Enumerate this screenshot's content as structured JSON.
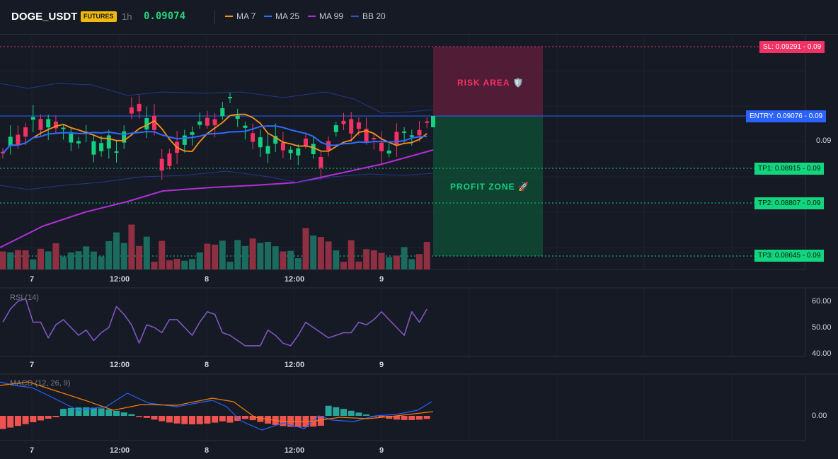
{
  "header": {
    "symbol": "DOGE_USDT",
    "badge": "FUTURES",
    "timeframe": "1h",
    "last_price": "0.09074",
    "legend": [
      {
        "label": "MA 7",
        "color": "#f7931a"
      },
      {
        "label": "MA 25",
        "color": "#2f6bff"
      },
      {
        "label": "MA 99",
        "color": "#b02fd6"
      },
      {
        "label": "BB 20",
        "color": "#23378a"
      }
    ]
  },
  "colors": {
    "bull": "#13d17f",
    "bear": "#f23264",
    "vol_bull": "#1b6b5f",
    "vol_bear": "#8e2f42",
    "ma7": "#f7931a",
    "ma25": "#2f6bff",
    "ma99": "#b02fd6",
    "bb": "#23378a",
    "rsi": "#7e57c2",
    "macd": "#2962ff",
    "signal": "#f57c00",
    "hist_pos": "#26a69a",
    "hist_neg": "#ef5350"
  },
  "trade": {
    "risk_label": "RISK AREA 🛡️",
    "profit_label": "PROFIT ZONE 🚀",
    "sl": "SL: 0.09291 - 0.09",
    "entry": "ENTRY: 0.09076 - 0.09",
    "tp1": "TP1: 0.08915 - 0.09",
    "tp2": "TP2: 0.08807 - 0.09",
    "tp3": "TP3: 0.08645 - 0.09"
  },
  "price_axis": {
    "tick": "0.09"
  },
  "time_axis": [
    "7",
    "12:00",
    "8",
    "12:00",
    "9"
  ],
  "rsi": {
    "label": "RSI (14)",
    "ticks": [
      "60.00",
      "50.00",
      "40.00"
    ],
    "values": [
      52,
      57,
      60,
      61,
      52,
      52,
      46,
      51,
      53,
      50,
      47,
      49,
      45,
      48,
      50,
      58,
      55,
      51,
      44,
      51,
      50,
      48,
      53,
      53,
      50,
      47,
      52,
      56,
      55,
      48,
      47,
      45,
      43,
      43,
      43,
      49,
      47,
      44,
      43,
      47,
      52,
      50,
      48,
      46,
      47,
      48,
      48,
      52,
      51,
      53,
      56,
      53,
      50,
      47,
      56,
      52,
      57
    ]
  },
  "macd": {
    "label": "MACD (12, 26, 9)",
    "tick": "0.00"
  }
}
